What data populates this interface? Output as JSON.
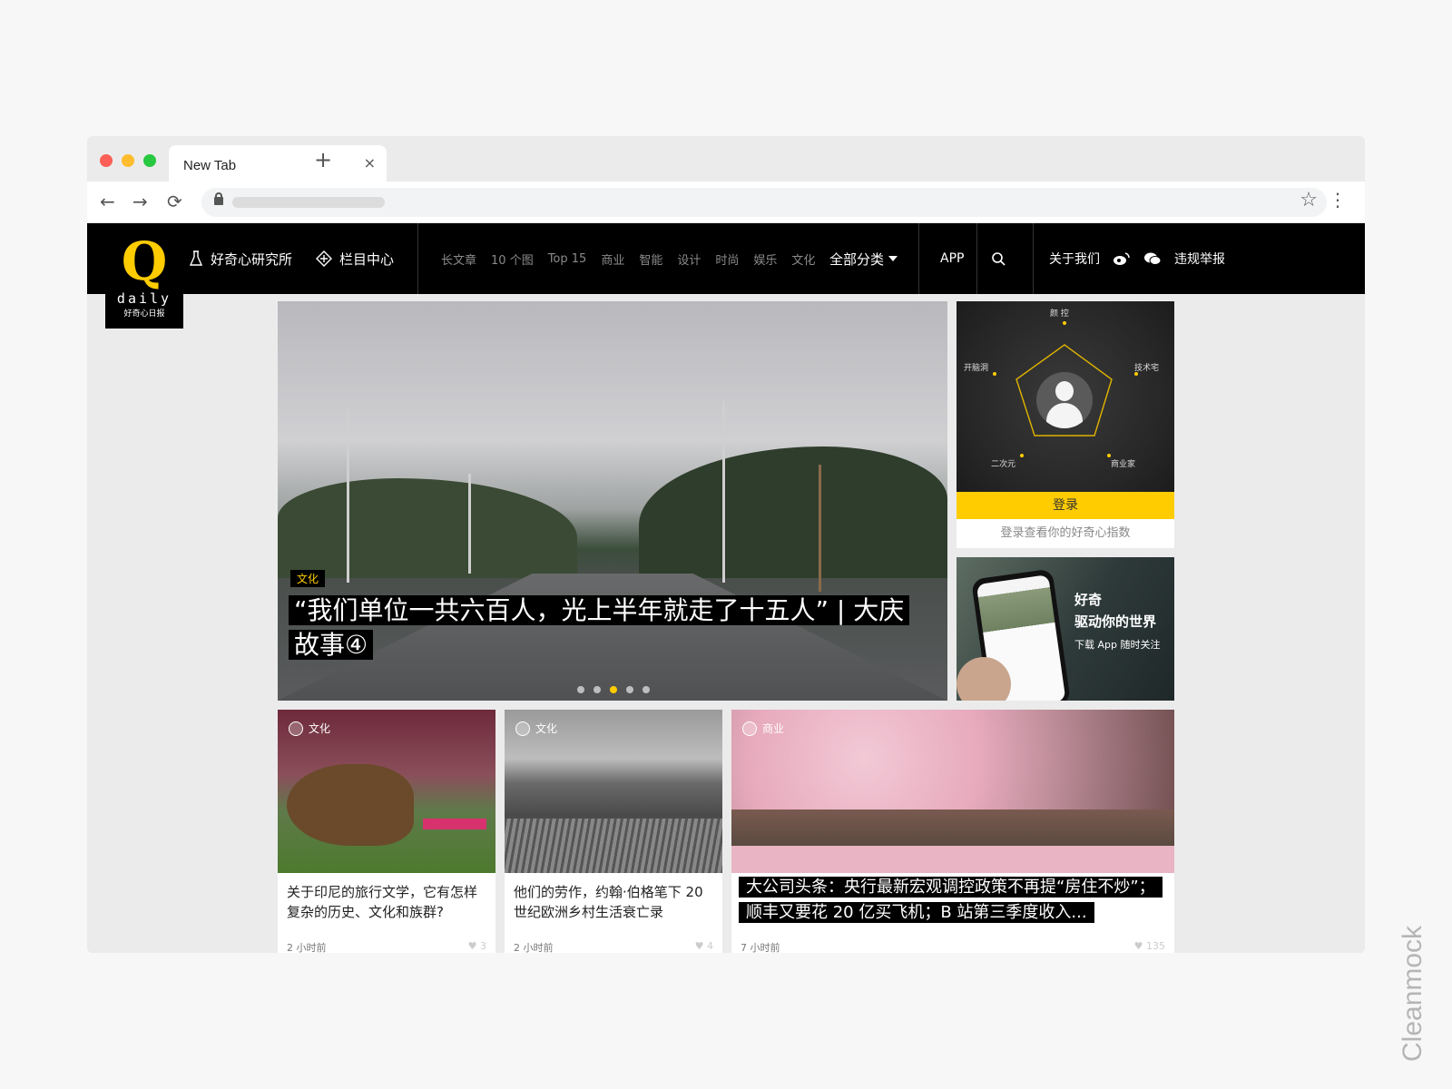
{
  "browser": {
    "tab_title": "New Tab",
    "tab_close": "×",
    "new_tab": "+",
    "nav": {
      "back": "←",
      "forward": "→",
      "reload": "⟳"
    },
    "bookmark_icon": "☆",
    "menu_icon": "⋮",
    "traffic_lights": [
      "#ff5f57",
      "#febc2e",
      "#28c840"
    ]
  },
  "header": {
    "logo": {
      "mark": "Q",
      "word": "daily",
      "cn": "好奇心日报"
    },
    "lab_label": "好奇心研究所",
    "columns_label": "栏目中心",
    "categories": [
      "长文章",
      "10 个图",
      "Top 15",
      "商业",
      "智能",
      "设计",
      "时尚",
      "娱乐",
      "文化"
    ],
    "all_categories": "全部分类",
    "app": "APP",
    "about": "关于我们",
    "report": "违规举报"
  },
  "hero": {
    "category": "文化",
    "title": "“我们单位一共六百人，光上半年就走了十五人” | 大庆故事④",
    "slide_count": 5,
    "active_slide": 3
  },
  "login_panel": {
    "labels": {
      "top": "颜 控",
      "left": "开脑洞",
      "right": "技术宅",
      "bottom_left": "二次元",
      "bottom_right": "商业家"
    },
    "login_button": "登录",
    "hint": "登录查看你的好奇心指数"
  },
  "app_promo": {
    "line1": "好奇",
    "line2": "驱动你的世界",
    "line3": "下载 App 随时关注"
  },
  "cards": [
    {
      "category": "文化",
      "title": "关于印尼的旅行文学，它有怎样复杂的历史、文化和族群?",
      "time": "2 小时前",
      "likes": "3"
    },
    {
      "category": "文化",
      "title": "他们的劳作，约翰·伯格笔下 20 世纪欧洲乡村生活衰亡录",
      "time": "2 小时前",
      "likes": "4"
    },
    {
      "category": "商业",
      "title": "大公司头条：央行最新宏观调控政策不再提“房住不炒”；顺丰又要花 20 亿买飞机；B 站第三季度收入...",
      "time": "7 小时前",
      "likes": "135"
    }
  ],
  "colors": {
    "accent": "#ffcc00",
    "header_bg": "#000000"
  },
  "watermark": "Cleanmock"
}
